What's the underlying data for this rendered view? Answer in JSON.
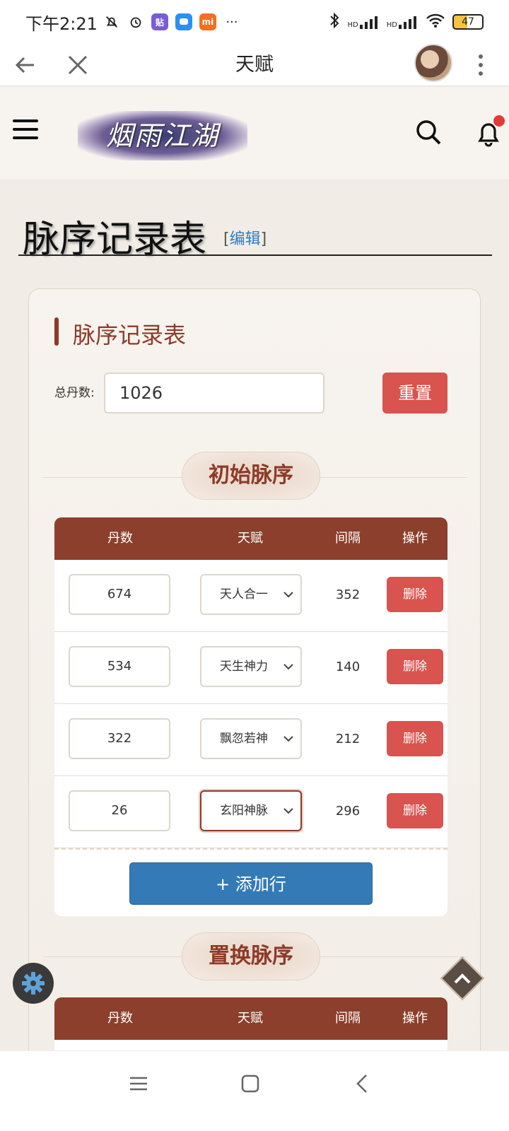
{
  "status": {
    "time": "下午2:21",
    "battery": "47",
    "icons": [
      "bell-off-icon",
      "alarm-icon",
      "app-tie-icon",
      "app-chat-icon",
      "app-mi-icon",
      "more-dots-icon"
    ],
    "app_tie_label": "贴",
    "app_mi_label": "mi",
    "more_label": "···",
    "hd_label": "HD",
    "accent_colors": {
      "tie": "#7b5cd6",
      "chat": "#2a8ff7",
      "mi": "#f36f21"
    }
  },
  "browser": {
    "title": "天赋"
  },
  "site": {
    "logo_text": "烟雨江湖"
  },
  "page": {
    "title": "脉序记录表",
    "edit_open": "[",
    "edit_label": "编辑",
    "edit_close": "]"
  },
  "card": {
    "title": "脉序记录表",
    "total_label": "总丹数:",
    "total_value": "1026",
    "reset_label": "重置",
    "add_row_label": "+ 添加行"
  },
  "sections": [
    {
      "title": "初始脉序"
    },
    {
      "title": "置换脉序"
    }
  ],
  "table": {
    "headers": [
      "丹数",
      "天赋",
      "间隔",
      "操作"
    ],
    "rows": [
      {
        "qty": "674",
        "talent": "天人合一",
        "gap": "352",
        "action": "删除"
      },
      {
        "qty": "534",
        "talent": "天生神力",
        "gap": "140",
        "action": "删除"
      },
      {
        "qty": "322",
        "talent": "飘忽若神",
        "gap": "212",
        "action": "删除"
      },
      {
        "qty": "26",
        "talent": "玄阳神脉",
        "gap": "296",
        "action": "删除"
      }
    ]
  },
  "colors": {
    "brand_red": "#8c3b28",
    "header_brown": "#8c3f2c",
    "danger": "#d9534f",
    "primary": "#337ab7"
  }
}
